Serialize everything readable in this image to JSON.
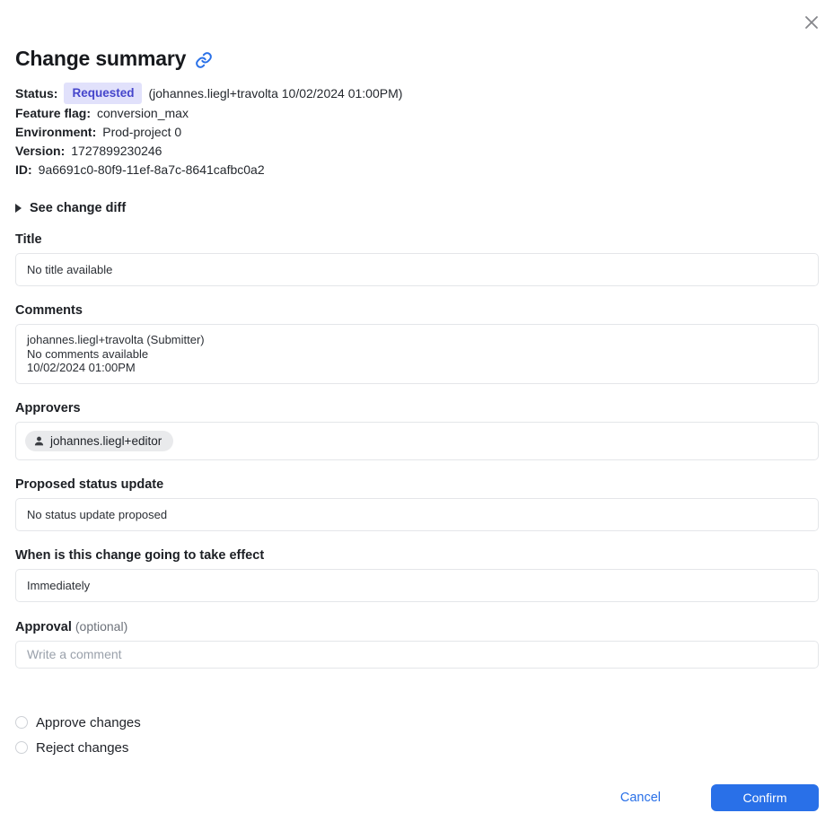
{
  "dialog": {
    "title": "Change summary"
  },
  "icons": {
    "close": "close-x",
    "link": "chain-link",
    "person": "person-bust",
    "disclosure": "triangle-right"
  },
  "meta": {
    "status_label": "Status:",
    "status_badge": "Requested",
    "status_detail": "(johannes.liegl+travolta 10/02/2024 01:00PM)",
    "rows": [
      {
        "label": "Feature flag:",
        "value": "conversion_max"
      },
      {
        "label": "Environment:",
        "value": "Prod-project 0"
      },
      {
        "label": "Version:",
        "value": "1727899230246"
      },
      {
        "label": "ID:",
        "value": "9a6691c0-80f9-11ef-8a7c-8641cafbc0a2"
      }
    ]
  },
  "diff_toggle": {
    "label": "See change diff"
  },
  "sections": {
    "title": {
      "label": "Title",
      "value": "No title available"
    },
    "comments": {
      "label": "Comments",
      "lines": [
        "johannes.liegl+travolta (Submitter)",
        "No comments available",
        "10/02/2024 01:00PM"
      ]
    },
    "approvers": {
      "label": "Approvers",
      "chip": "johannes.liegl+editor"
    },
    "status_update": {
      "label": "Proposed status update",
      "value": "No status update proposed"
    },
    "effect": {
      "label": "When is this change going to take effect",
      "value": "Immediately"
    },
    "approval": {
      "label": "Approval",
      "optional": "(optional)",
      "placeholder": "Write a comment"
    }
  },
  "choices": {
    "approve_label": "Approve changes",
    "reject_label": "Reject changes"
  },
  "footer": {
    "cancel_label": "Cancel",
    "confirm_label": "Confirm"
  },
  "colors": {
    "accent_blue": "#2970e8",
    "badge_bg": "#e1e1fb",
    "badge_text": "#4545cb",
    "border": "#e4e6e9",
    "chip_bg": "#e9eaec"
  }
}
